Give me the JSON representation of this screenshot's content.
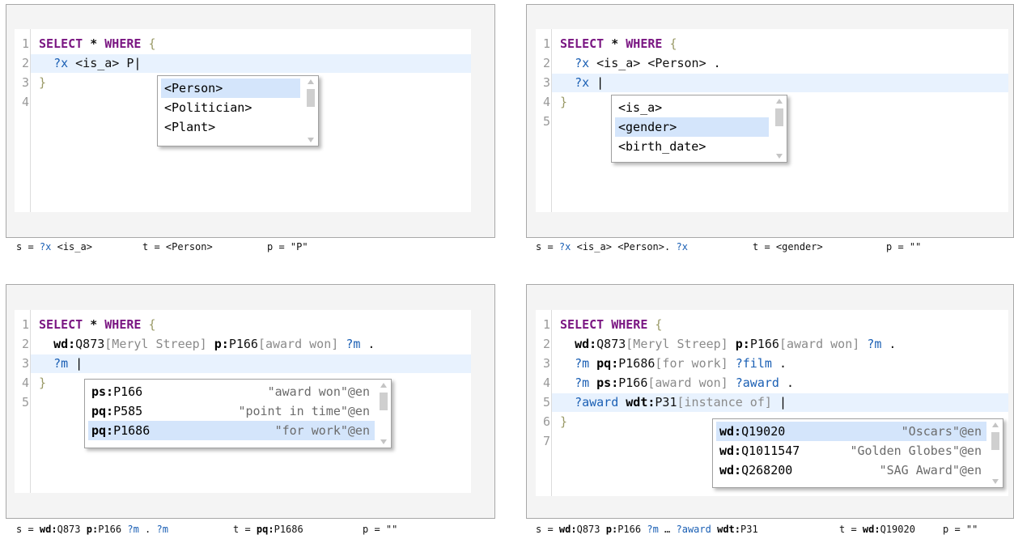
{
  "panels": [
    {
      "line_numbers": [
        "1",
        "2",
        "3",
        "4"
      ],
      "caption": {
        "s": "?x <is_a>",
        "t": "<Person>",
        "p": "\"P\""
      },
      "dropdown": {
        "items": [
          "<Person>",
          "<Politician>",
          "<Plant>"
        ]
      }
    },
    {
      "line_numbers": [
        "1",
        "2",
        "3",
        "4",
        "5"
      ],
      "caption": {
        "s": "<Person>. ?x",
        "t": "<gender>",
        "p": "\"\""
      },
      "dropdown": {
        "items": [
          "<is_a>",
          "<gender>",
          "<birth_date>"
        ]
      }
    },
    {
      "line_numbers": [
        "1",
        "2",
        "3",
        "4",
        "5"
      ],
      "caption": {
        "t": "P1686",
        "p": "\"\""
      },
      "dropdown": {
        "items": [
          {
            "prefix": "ps:",
            "id": "P166",
            "label": "\"award won\"@en"
          },
          {
            "prefix": "pq:",
            "id": "P585",
            "label": "\"point in time\"@en"
          },
          {
            "prefix": "pq:",
            "id": "P1686",
            "label": "\"for work\"@en"
          }
        ]
      }
    },
    {
      "line_numbers": [
        "1",
        "2",
        "3",
        "4",
        "5",
        "6",
        "7"
      ],
      "caption": {
        "t": "Q19020",
        "p": "\"\""
      },
      "dropdown": {
        "items": [
          {
            "prefix": "wd:",
            "id": "Q19020",
            "label": "\"Oscars\"@en"
          },
          {
            "prefix": "wd:",
            "id": "Q1011547",
            "label": "\"Golden Globes\"@en"
          },
          {
            "prefix": "wd:",
            "id": "Q268200",
            "label": "\"SAG Award\"@en"
          }
        ]
      }
    }
  ],
  "code": {
    "select": "SELECT",
    "star": "*",
    "where": "WHERE",
    "lbrace": "{",
    "rbrace": "}",
    "cursor": "|",
    "p1_line2": {
      "var": "?x",
      "pred": "<is_a>",
      "typed": "P"
    },
    "p2_line2": {
      "var": "?x",
      "pred": "<is_a>",
      "obj": "<Person>",
      "dot": "."
    },
    "p2_line3": {
      "var": "?x"
    },
    "wd_prefix": "wd:",
    "p_prefix": "p:",
    "pq_prefix": "pq:",
    "ps_prefix": "ps:",
    "wdt_prefix": "wdt:",
    "q873": "Q873",
    "meryl": "[Meryl Streep]",
    "p166": "P166",
    "award_won": "[award won]",
    "var_m": "?m",
    "dot": ".",
    "p1686": "P1686",
    "for_work": "[for work]",
    "var_film": "?film",
    "var_award": "?award",
    "p31": "P31",
    "instance_of": "[instance of]"
  },
  "captions_common": {
    "s_label": "s =",
    "t_label": "t =",
    "p_label": "p =",
    "var_x": "?x",
    "is_a": "<is_a>",
    "ellipsis": "…"
  }
}
